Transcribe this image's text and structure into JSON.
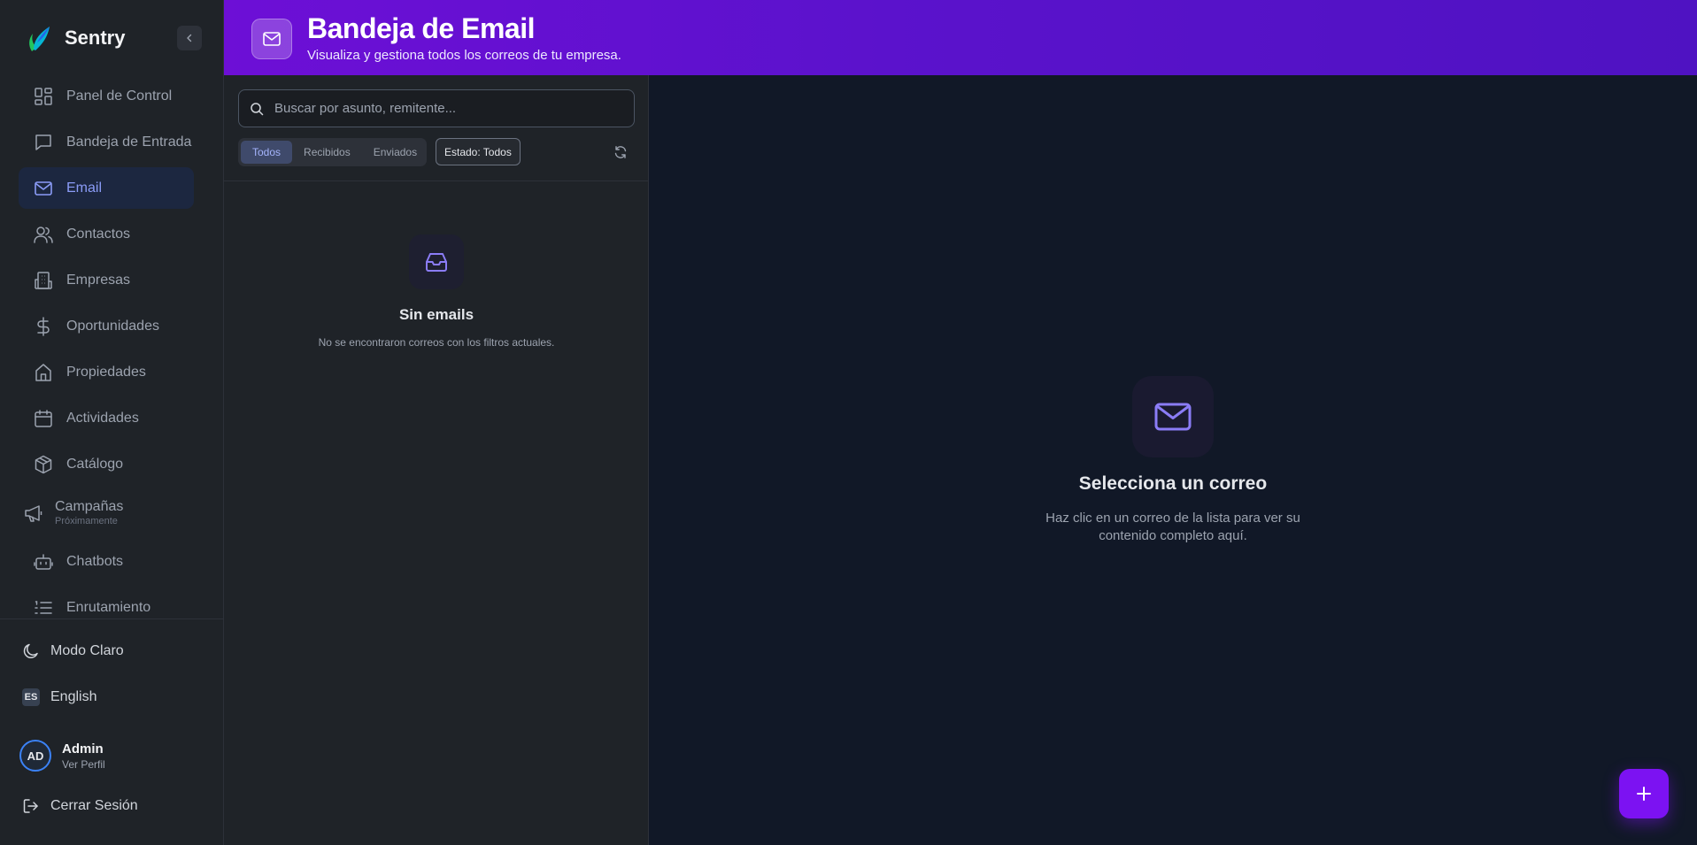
{
  "app": {
    "name": "Sentry"
  },
  "sidebar": {
    "items": [
      {
        "label": "Panel de Control",
        "icon": "dashboard-icon"
      },
      {
        "label": "Bandeja de Entrada",
        "icon": "chat-icon"
      },
      {
        "label": "Email",
        "icon": "mail-icon",
        "active": true
      },
      {
        "label": "Contactos",
        "icon": "users-icon"
      },
      {
        "label": "Empresas",
        "icon": "building-icon"
      },
      {
        "label": "Oportunidades",
        "icon": "dollar-icon"
      },
      {
        "label": "Propiedades",
        "icon": "home-icon"
      },
      {
        "label": "Actividades",
        "icon": "calendar-icon"
      },
      {
        "label": "Catálogo",
        "icon": "package-icon"
      },
      {
        "label": "Campañas",
        "sublabel": "Próximamente",
        "icon": "megaphone-icon"
      },
      {
        "label": "Chatbots",
        "icon": "bot-icon"
      },
      {
        "label": "Enrutamiento",
        "icon": "list-icon"
      }
    ],
    "theme_toggle": "Modo Claro",
    "language": {
      "badge": "ES",
      "label": "English"
    },
    "user": {
      "initials": "AD",
      "name": "Admin",
      "link": "Ver Perfil"
    },
    "logout": "Cerrar Sesión"
  },
  "header": {
    "title": "Bandeja de Email",
    "subtitle": "Visualiza y gestiona todos los correos de tu empresa."
  },
  "list": {
    "search": {
      "placeholder": "Buscar por asunto, remitente...",
      "value": ""
    },
    "tabs": [
      {
        "label": "Todos",
        "active": true
      },
      {
        "label": "Recibidos",
        "active": false
      },
      {
        "label": "Enviados",
        "active": false
      }
    ],
    "status_filter": "Estado: Todos",
    "empty": {
      "title": "Sin emails",
      "description": "No se encontraron correos con los filtros actuales."
    }
  },
  "detail": {
    "empty": {
      "title": "Selecciona un correo",
      "description": "Haz clic en un correo de la lista para ver su contenido completo aquí."
    }
  },
  "colors": {
    "accent": "#7c12f2",
    "header_gradient_start": "#6d0fd6",
    "header_gradient_end": "#4f12c2",
    "active_nav_text": "#8b9cf7",
    "icon_purple": "#8b7cf6"
  }
}
